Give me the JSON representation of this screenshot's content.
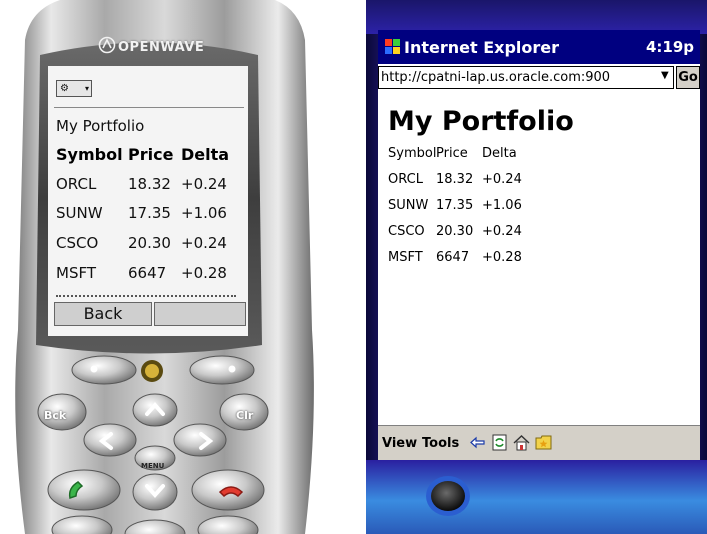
{
  "phone": {
    "brand": "OPENWAVE",
    "screen": {
      "menu_button": "⚙",
      "title": "My Portfolio",
      "columns": [
        "Symbol",
        "Price",
        "Delta"
      ],
      "rows": [
        {
          "symbol": "ORCL",
          "price": "18.32",
          "delta": "+0.24"
        },
        {
          "symbol": "SUNW",
          "price": "17.35",
          "delta": "+1.06"
        },
        {
          "symbol": "CSCO",
          "price": "20.30",
          "delta": "+0.24"
        },
        {
          "symbol": "MSFT",
          "price": "6647",
          "delta": "+0.28"
        }
      ],
      "softkey_left": "Back",
      "softkey_right": ""
    },
    "keys": {
      "back": "Bck",
      "clear": "Clr",
      "menu": "MENU"
    }
  },
  "pocketpc": {
    "titlebar": {
      "app_icon": "windows-flag-icon",
      "title": "Internet Explorer",
      "time": "4:19p"
    },
    "address": {
      "value": "http://cpatni-lap.us.oracle.com:900",
      "go_label": "Go"
    },
    "page": {
      "heading": "My Portfolio",
      "columns": [
        "Symbol",
        "Price",
        "Delta"
      ],
      "rows": [
        {
          "symbol": "ORCL",
          "price": "18.32",
          "delta": "+0.24"
        },
        {
          "symbol": "SUNW",
          "price": "17.35",
          "delta": "+1.06"
        },
        {
          "symbol": "CSCO",
          "price": "20.30",
          "delta": "+0.24"
        },
        {
          "symbol": "MSFT",
          "price": "6647",
          "delta": "+0.28"
        }
      ]
    },
    "toolbar": {
      "view_label": "View",
      "tools_label": "Tools",
      "icons": [
        "back-arrow-icon",
        "refresh-icon",
        "home-icon",
        "favorites-icon"
      ]
    },
    "colors": {
      "titlebar": "#000080",
      "frame": "#3b2cc0",
      "toolbar": "#d4d0c8"
    }
  }
}
